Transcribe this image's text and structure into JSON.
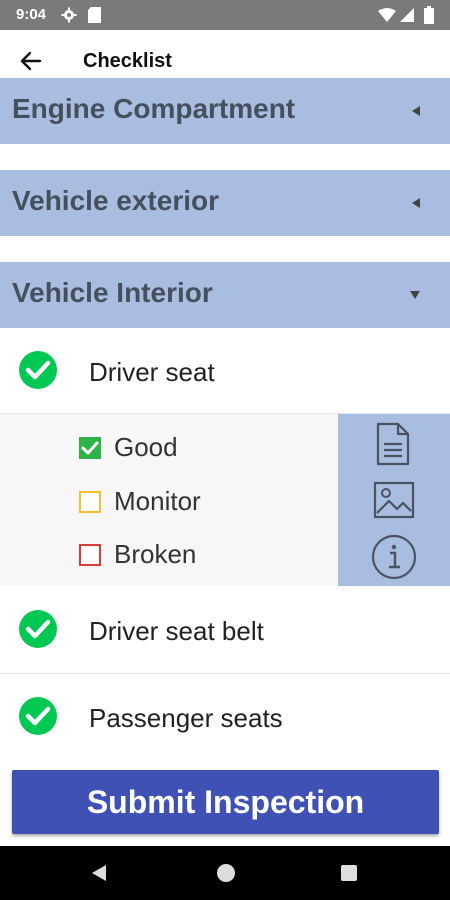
{
  "status_bar": {
    "time": "9:04",
    "icons": [
      "settings-gear-icon",
      "sd-card-icon",
      "wifi-icon",
      "signal-icon",
      "battery-icon"
    ]
  },
  "app_bar": {
    "title": "Checklist",
    "back_icon": "arrow-back-icon"
  },
  "sections": [
    {
      "label": "Engine Compartment",
      "state": "collapsed"
    },
    {
      "label": "Vehicle exterior",
      "state": "collapsed"
    },
    {
      "label": "Vehicle Interior",
      "state": "expanded"
    }
  ],
  "items": [
    {
      "label": "Driver seat",
      "checked": true,
      "expanded": true
    },
    {
      "label": "Driver seat belt",
      "checked": true
    },
    {
      "label": "Passenger seats",
      "checked": true
    }
  ],
  "condition_options": [
    {
      "label": "Good",
      "selected": true,
      "color": "#2db34a"
    },
    {
      "label": "Monitor",
      "selected": false,
      "color": "#f2c12e"
    },
    {
      "label": "Broken",
      "selected": false,
      "color": "#d93a3a"
    }
  ],
  "item_tools": [
    "document-icon",
    "image-icon",
    "info-icon"
  ],
  "submit_label": "Submit Inspection",
  "colors": {
    "section_bg": "#a9bde0",
    "check_green": "#00c853",
    "submit_bg": "#3f51b5",
    "status_bar": "#7a7a7a"
  },
  "nav_icons": [
    "back-triangle-icon",
    "home-circle-icon",
    "recents-square-icon"
  ]
}
